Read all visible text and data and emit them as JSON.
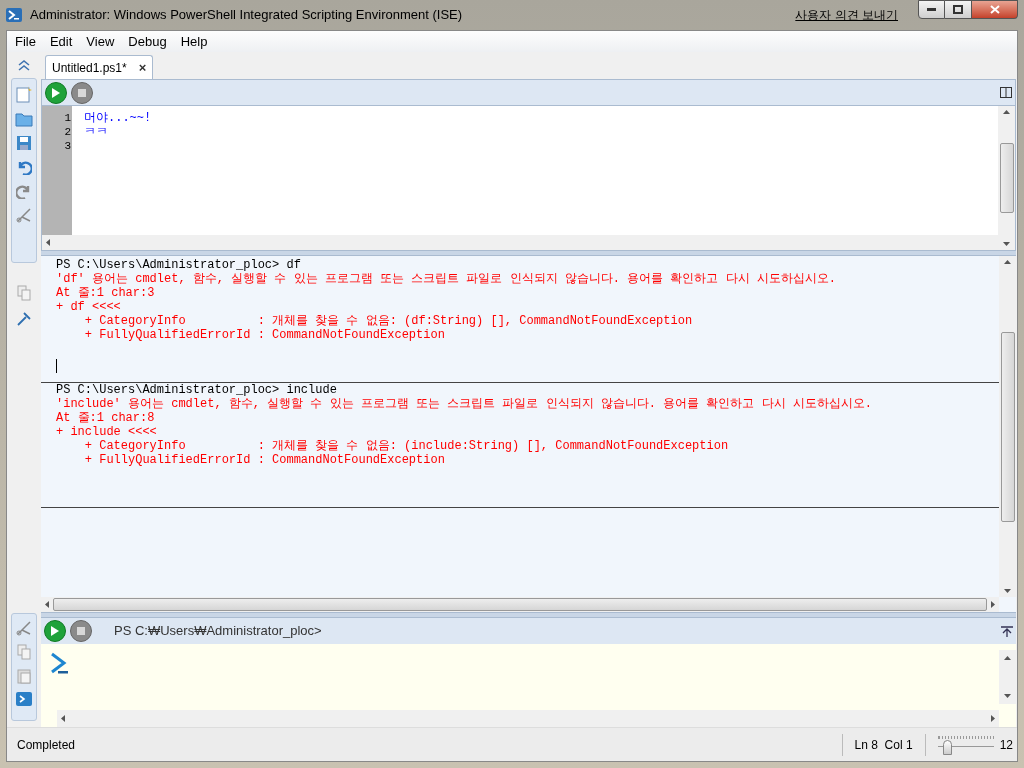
{
  "window": {
    "title": "Administrator: Windows PowerShell Integrated Scripting Environment (ISE)",
    "feedback_link": "사용자 의견 보내기"
  },
  "menu": [
    "File",
    "Edit",
    "View",
    "Debug",
    "Help"
  ],
  "script_tabs": [
    {
      "label": "Untitled1.ps1*",
      "selected": true
    }
  ],
  "close_glyph": "×",
  "editor_lines": [
    {
      "number": "1",
      "text": "머야...~~!"
    },
    {
      "number": "2",
      "text": "ㅋㅋ"
    },
    {
      "number": "3"
    }
  ],
  "output_blocks": [
    {
      "lines": [
        {
          "kind": "prompt",
          "text": "PS C:\\Users\\Administrator_ploc> df"
        },
        {
          "kind": "error",
          "text": "'df' 용어는 cmdlet, 함수, 실행할 수 있는 프로그램 또는 스크립트 파일로 인식되지 않습니다. 용어를 확인하고 다시 시도하십시오."
        },
        {
          "kind": "error",
          "text": "At 줄:1 char:3"
        },
        {
          "kind": "error",
          "text": "+ df <<<<"
        },
        {
          "kind": "error",
          "text": "    + CategoryInfo          : 개체를 찾을 수 없음: (df:String) [], CommandNotFoundException"
        },
        {
          "kind": "error",
          "text": "    + FullyQualifiedErrorId : CommandNotFoundException"
        },
        {
          "kind": "caret"
        }
      ]
    },
    {
      "lines": [
        {
          "kind": "prompt",
          "text": "PS C:\\Users\\Administrator_ploc> include"
        },
        {
          "kind": "error",
          "text": "'include' 용어는 cmdlet, 함수, 실행할 수 있는 프로그램 또는 스크립트 파일로 인식되지 않습니다. 용어를 확인하고 다시 시도하십시오."
        },
        {
          "kind": "error",
          "text": "At 줄:1 char:8"
        },
        {
          "kind": "error",
          "text": "+ include <<<<"
        },
        {
          "kind": "error",
          "text": "    + CategoryInfo          : 개체를 찾을 수 없음: (include:String) [], CommandNotFoundException"
        },
        {
          "kind": "error",
          "text": "    + FullyQualifiedErrorId : CommandNotFoundException"
        }
      ]
    }
  ],
  "command_pane": {
    "prompt": "PS C:₩Users₩Administrator_ploc>"
  },
  "status_bar": {
    "status": "Completed",
    "position": "Ln 8  Col 1",
    "zoom": {
      "level": 0.12,
      "reading": "12"
    }
  }
}
